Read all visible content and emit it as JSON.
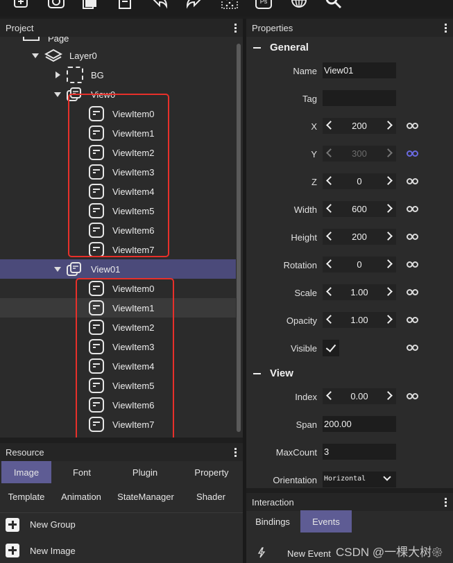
{
  "toolbar": {
    "icons": [
      "add-image-icon",
      "camera-icon",
      "copy-icon",
      "document-icon",
      "undo-icon",
      "redo-icon",
      "grid-icon",
      "ps-icon",
      "globe-icon",
      "search-icon"
    ],
    "ps_text": "Ps"
  },
  "project": {
    "title": "Project",
    "tree": {
      "page": "Page",
      "layer": "Layer0",
      "bg": "BG",
      "view0": "View0",
      "view0_items": [
        "ViewItem0",
        "ViewItem1",
        "ViewItem2",
        "ViewItem3",
        "ViewItem4",
        "ViewItem5",
        "ViewItem6",
        "ViewItem7"
      ],
      "view01": "View01",
      "view01_items": [
        "ViewItem0",
        "ViewItem1",
        "ViewItem2",
        "ViewItem3",
        "ViewItem4",
        "ViewItem5",
        "ViewItem6",
        "ViewItem7"
      ]
    }
  },
  "resource": {
    "title": "Resource",
    "tabs": [
      "Image",
      "Font",
      "Plugin",
      "Property",
      "Template",
      "Animation",
      "StateManager",
      "Shader"
    ],
    "active_tab": "Image",
    "actions": [
      "New Group",
      "New Image"
    ]
  },
  "properties": {
    "title": "Properties",
    "general": {
      "title": "General",
      "name_label": "Name",
      "name_value": "View01",
      "tag_label": "Tag",
      "tag_value": "",
      "x_label": "X",
      "x_value": "200",
      "y_label": "Y",
      "y_value": "300",
      "z_label": "Z",
      "z_value": "0",
      "width_label": "Width",
      "width_value": "600",
      "height_label": "Height",
      "height_value": "200",
      "rotation_label": "Rotation",
      "rotation_value": "0",
      "scale_label": "Scale",
      "scale_value": "1.00",
      "opacity_label": "Opacity",
      "opacity_value": "1.00",
      "visible_label": "Visible",
      "visible_value": true
    },
    "view": {
      "title": "View",
      "index_label": "Index",
      "index_value": "0.00",
      "span_label": "Span",
      "span_value": "200.00",
      "maxcount_label": "MaxCount",
      "maxcount_value": "3",
      "orientation_label": "Orientation",
      "orientation_value": "Horizontal"
    }
  },
  "interaction": {
    "title": "Interaction",
    "tabs": [
      "Bindings",
      "Events"
    ],
    "active_tab": "Events",
    "new_event": "New Event"
  },
  "watermark": "CSDN @一棵大树𑁍",
  "colors": {
    "selection": "#4b4a7a",
    "active_tab": "#5e5c94",
    "highlight_box": "#e8302a",
    "link_active": "#6a6ae0"
  }
}
